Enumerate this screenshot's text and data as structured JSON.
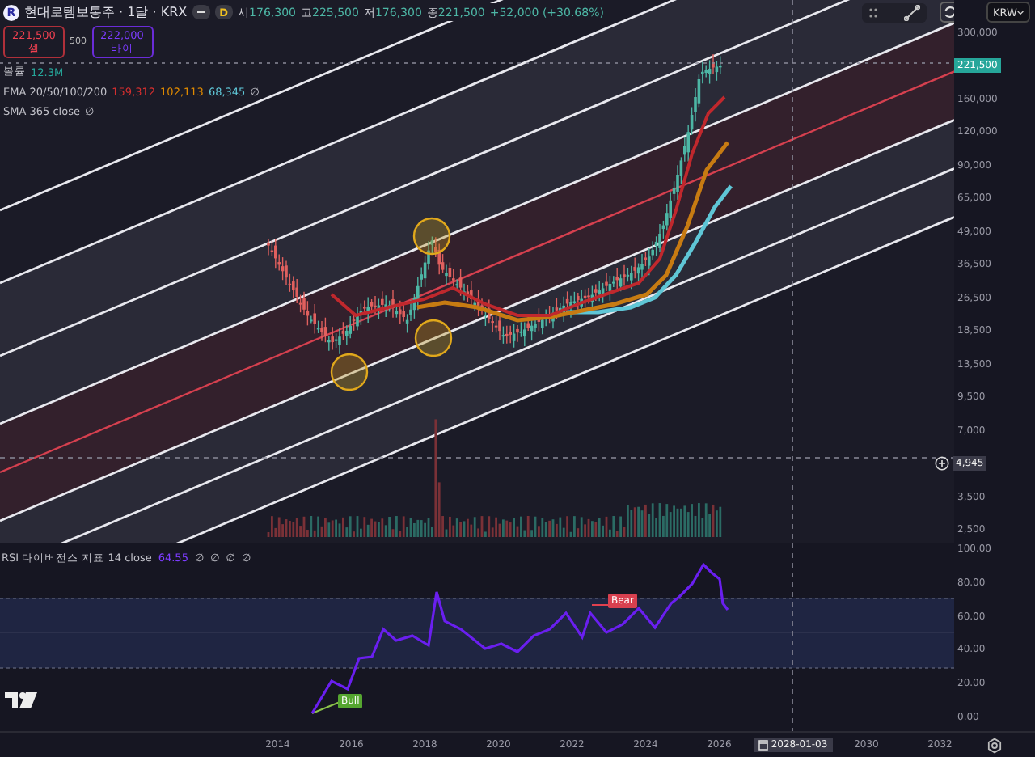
{
  "symbol": {
    "logo_letter": "R",
    "title": "현대로템보통주 · 1달 · KRX",
    "toggle": "D",
    "ohlc": [
      {
        "label": "시",
        "value": "176,300"
      },
      {
        "label": "고",
        "value": "225,500"
      },
      {
        "label": "저",
        "value": "176,300"
      },
      {
        "label": "종",
        "value": "221,500"
      }
    ],
    "change": "+52,000 (+30.68%)"
  },
  "trade": {
    "sell": {
      "price": "221,500",
      "label": "셀"
    },
    "spread": "500",
    "buy": {
      "price": "222,000",
      "label": "바이"
    }
  },
  "indicators": [
    {
      "name": "볼륨",
      "values": [
        {
          "text": "12.3M",
          "color": "#26a69a"
        }
      ]
    },
    {
      "name": "EMA 20/50/100/200",
      "values": [
        {
          "text": "159,312",
          "color": "#d32f2f"
        },
        {
          "text": "102,113",
          "color": "#e08a00"
        },
        {
          "text": "68,345",
          "color": "#5fc6d6"
        }
      ],
      "marks": [
        "∅"
      ]
    },
    {
      "name": "SMA 365 close",
      "marks": [
        "∅"
      ]
    }
  ],
  "currency": "KRW",
  "price_axis": [
    {
      "kind": "tick",
      "text": "300,000"
    },
    {
      "kind": "last",
      "text": "221,500"
    },
    {
      "kind": "tick",
      "text": "160,000"
    },
    {
      "kind": "tick",
      "text": "120,000"
    },
    {
      "kind": "tick",
      "text": "90,000"
    },
    {
      "kind": "tick",
      "text": "65,000"
    },
    {
      "kind": "tick",
      "text": "49,000"
    },
    {
      "kind": "tick",
      "text": "36,500"
    },
    {
      "kind": "tick",
      "text": "26,500"
    },
    {
      "kind": "tick",
      "text": "18,500"
    },
    {
      "kind": "tick",
      "text": "13,500"
    },
    {
      "kind": "tick",
      "text": "9,500"
    },
    {
      "kind": "tick",
      "text": "7,000"
    },
    {
      "kind": "crosshair",
      "text": "4,945"
    },
    {
      "kind": "tick",
      "text": "3,500"
    },
    {
      "kind": "tick",
      "text": "2,500"
    }
  ],
  "rsi": {
    "legend": "RSI 다이버전스 지표 14 close",
    "value": "64.55",
    "marks": [
      "∅",
      "∅",
      "∅",
      "∅"
    ],
    "bull_label": "Bull",
    "bear_label": "Bear",
    "axis": [
      "100.00",
      "80.00",
      "60.00",
      "40.00",
      "20.00",
      "0.00"
    ]
  },
  "time_axis": [
    {
      "kind": "tick",
      "text": "2014"
    },
    {
      "kind": "tick",
      "text": "2016"
    },
    {
      "kind": "tick",
      "text": "2018"
    },
    {
      "kind": "tick",
      "text": "2020"
    },
    {
      "kind": "tick",
      "text": "2022"
    },
    {
      "kind": "tick",
      "text": "2024"
    },
    {
      "kind": "tick",
      "text": "2026"
    },
    {
      "kind": "crosshair",
      "text": "2028-01-03"
    },
    {
      "kind": "tick",
      "text": "2030"
    },
    {
      "kind": "tick",
      "text": "2032"
    }
  ]
}
